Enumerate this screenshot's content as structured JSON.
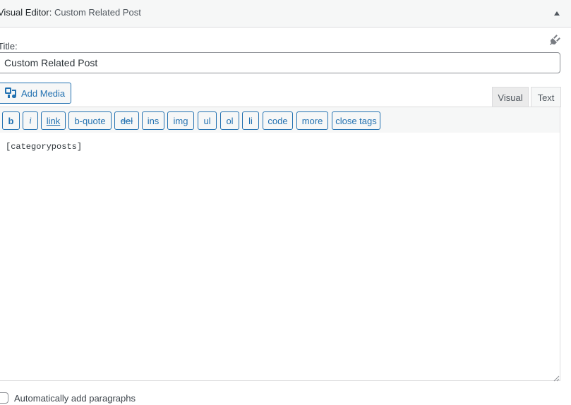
{
  "widget": {
    "title_prefix": "Visual Editor:",
    "title_name": "Custom Related Post",
    "toggle_icon": "triangle-up-icon"
  },
  "plugin_icon": "plug-icon",
  "title_field": {
    "label": "Title:",
    "value": "Custom Related Post"
  },
  "media": {
    "add_media_label": "Add Media",
    "icon": "media-icon"
  },
  "tabs": {
    "visual_label": "Visual",
    "text_label": "Text",
    "active": "Text"
  },
  "toolbar": {
    "buttons": [
      "b",
      "i",
      "link",
      "b-quote",
      "del",
      "ins",
      "img",
      "ul",
      "ol",
      "li",
      "code",
      "more",
      "close tags"
    ]
  },
  "editor": {
    "content": "[categoryposts]"
  },
  "auto_paragraphs": {
    "label": "Automatically add paragraphs",
    "checked": false
  },
  "colors": {
    "accent": "#2271b1",
    "header_bg": "#f6f7f7",
    "border": "#dcdcde"
  }
}
